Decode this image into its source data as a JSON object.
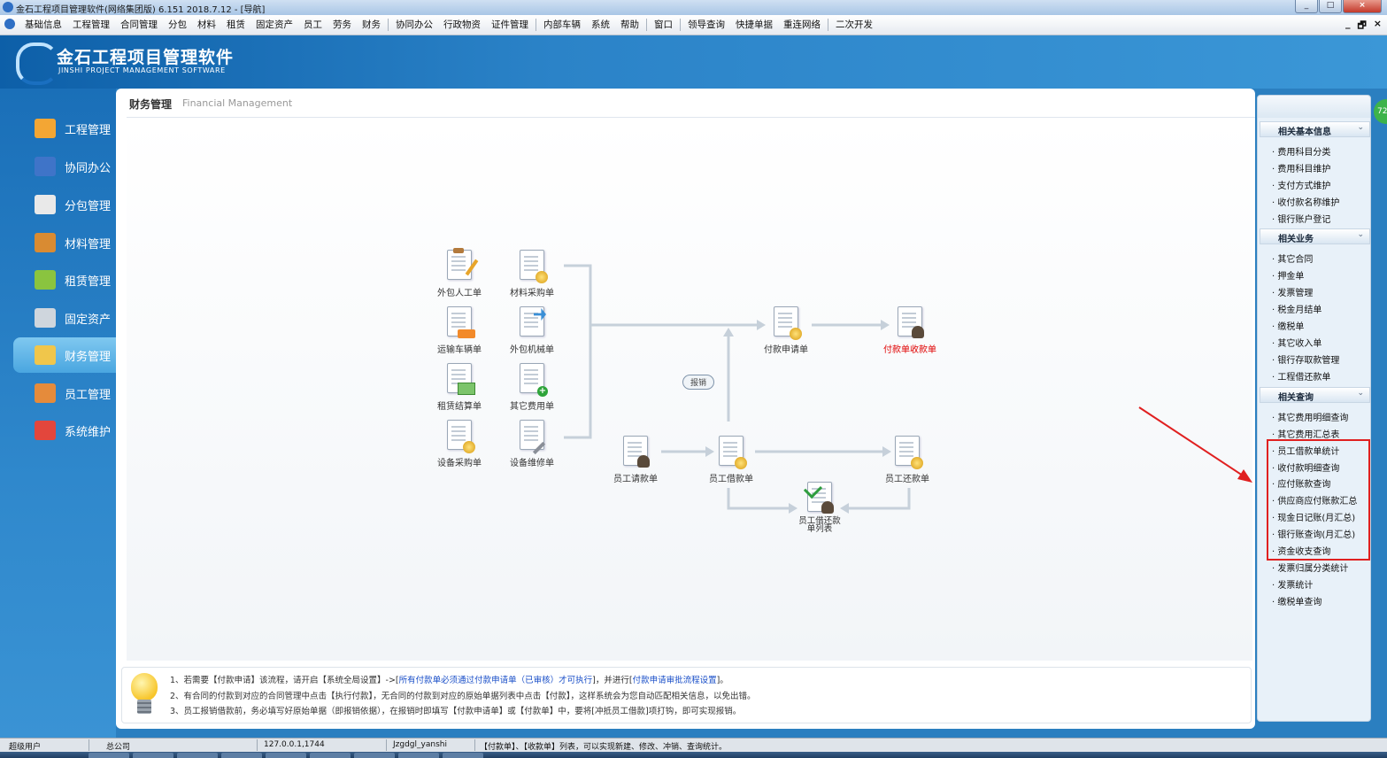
{
  "window": {
    "title": "金石工程项目管理软件(网络集团版) 6.151  2018.7.12 - [导航]",
    "btn_min": "_",
    "btn_max": "□",
    "btn_close": "×"
  },
  "menubar": {
    "items": [
      "基础信息",
      "工程管理",
      "合同管理",
      "分包",
      "材料",
      "租赁",
      "固定资产",
      "员工",
      "劳务",
      "财务",
      "协同办公",
      "行政物资",
      "证件管理",
      "内部车辆",
      "系统",
      "帮助",
      "窗口",
      "领导查询",
      "快捷单据",
      "重连网络",
      "二次开发"
    ],
    "mdi_controls": [
      "_",
      "🗗",
      "×"
    ]
  },
  "header": {
    "logo_cn": "金石工程项目管理软件",
    "logo_en": "JINSHI PROJECT MANAGEMENT SOFTWARE"
  },
  "sidebar": {
    "items": [
      {
        "label": "工程管理",
        "icon": "worker-icon",
        "color": "#f3a634"
      },
      {
        "label": "协同办公",
        "icon": "network-icon",
        "color": "#3f74c8"
      },
      {
        "label": "分包管理",
        "icon": "handshake-icon",
        "color": "#e9e9e9"
      },
      {
        "label": "材料管理",
        "icon": "box-icon",
        "color": "#d98b32"
      },
      {
        "label": "租赁管理",
        "icon": "cubes-icon",
        "color": "#8ac43f"
      },
      {
        "label": "固定资产",
        "icon": "server-icon",
        "color": "#cfd6dd"
      },
      {
        "label": "财务管理",
        "icon": "money-icon",
        "color": "#f0c64b",
        "active": true
      },
      {
        "label": "员工管理",
        "icon": "staff-icon",
        "color": "#e58b3b"
      },
      {
        "label": "系统维护",
        "icon": "tools-icon",
        "color": "#e3463c"
      }
    ]
  },
  "page": {
    "title": "财务管理",
    "title_en": "Financial Management"
  },
  "flow": {
    "nodes": {
      "outsource_labor": "外包人工单",
      "material_purchase": "材料采购单",
      "transport_vehicle": "运输车辆单",
      "outsource_machine": "外包机械单",
      "lease_settlement": "租赁结算单",
      "other_expense": "其它费用单",
      "equipment_purchase": "设备采购单",
      "equipment_repair": "设备维修单",
      "payment_request": "付款申请单",
      "payment_receipt": "付款单收款单",
      "employee_request": "员工请款单",
      "employee_loan": "员工借款单",
      "employee_repay": "员工还款单",
      "loan_repay_list": "员工借还款单列表"
    },
    "reimburse_label": "报销"
  },
  "notice": {
    "line1_a": "1、若需要【付款申请】该流程，请开启【系统全局设置】->[",
    "line1_b": "所有付款单必须通过付款申请单（已审核）才可执行",
    "line1_c": "]，并进行[",
    "line1_d": "付款申请审批流程设置",
    "line1_e": "]。",
    "line2": "2、有合同的付款到对应的合同管理中点击【执行付款】，无合同的付款到对应的原始单据列表中点击【付款】，这样系统会为您自动匹配相关信息，以免出错。",
    "line3": "3、员工报销借款前，务必填写好原始单据（即报销依据），在报销时即填写【付款申请单】或【付款单】中，要将[冲抵员工借款]项打钩，即可实现报销。"
  },
  "right_panel": {
    "sections": [
      {
        "title": "相关基本信息",
        "links": [
          "费用科目分类",
          "费用科目维护",
          "支付方式维护",
          "收付款名称维护",
          "银行账户登记"
        ]
      },
      {
        "title": "相关业务",
        "links": [
          "其它合同",
          "押金单",
          "发票管理",
          "税金月结单",
          "缴税单",
          "其它收入单",
          "银行存取款管理",
          "工程借还款单"
        ]
      },
      {
        "title": "相关查询",
        "links": [
          "其它费用明细查询",
          "其它费用汇总表",
          "员工借款单统计",
          "收付款明细查询",
          "应付账款查询",
          "供应商应付账款汇总",
          "现金日记账(月汇总)",
          "银行账查询(月汇总)",
          "资金收支查询",
          "发票归属分类统计",
          "发票统计",
          "缴税单查询"
        ]
      }
    ]
  },
  "status": {
    "user": "超级用户",
    "company": "总公司",
    "ip": "127.0.0.1,1744",
    "db": "Jzgdgl_yanshi",
    "tip": "【付款单】、【收款单】列表，可以实现新建、修改、冲销、查询统计。"
  },
  "side_bubble": "72"
}
